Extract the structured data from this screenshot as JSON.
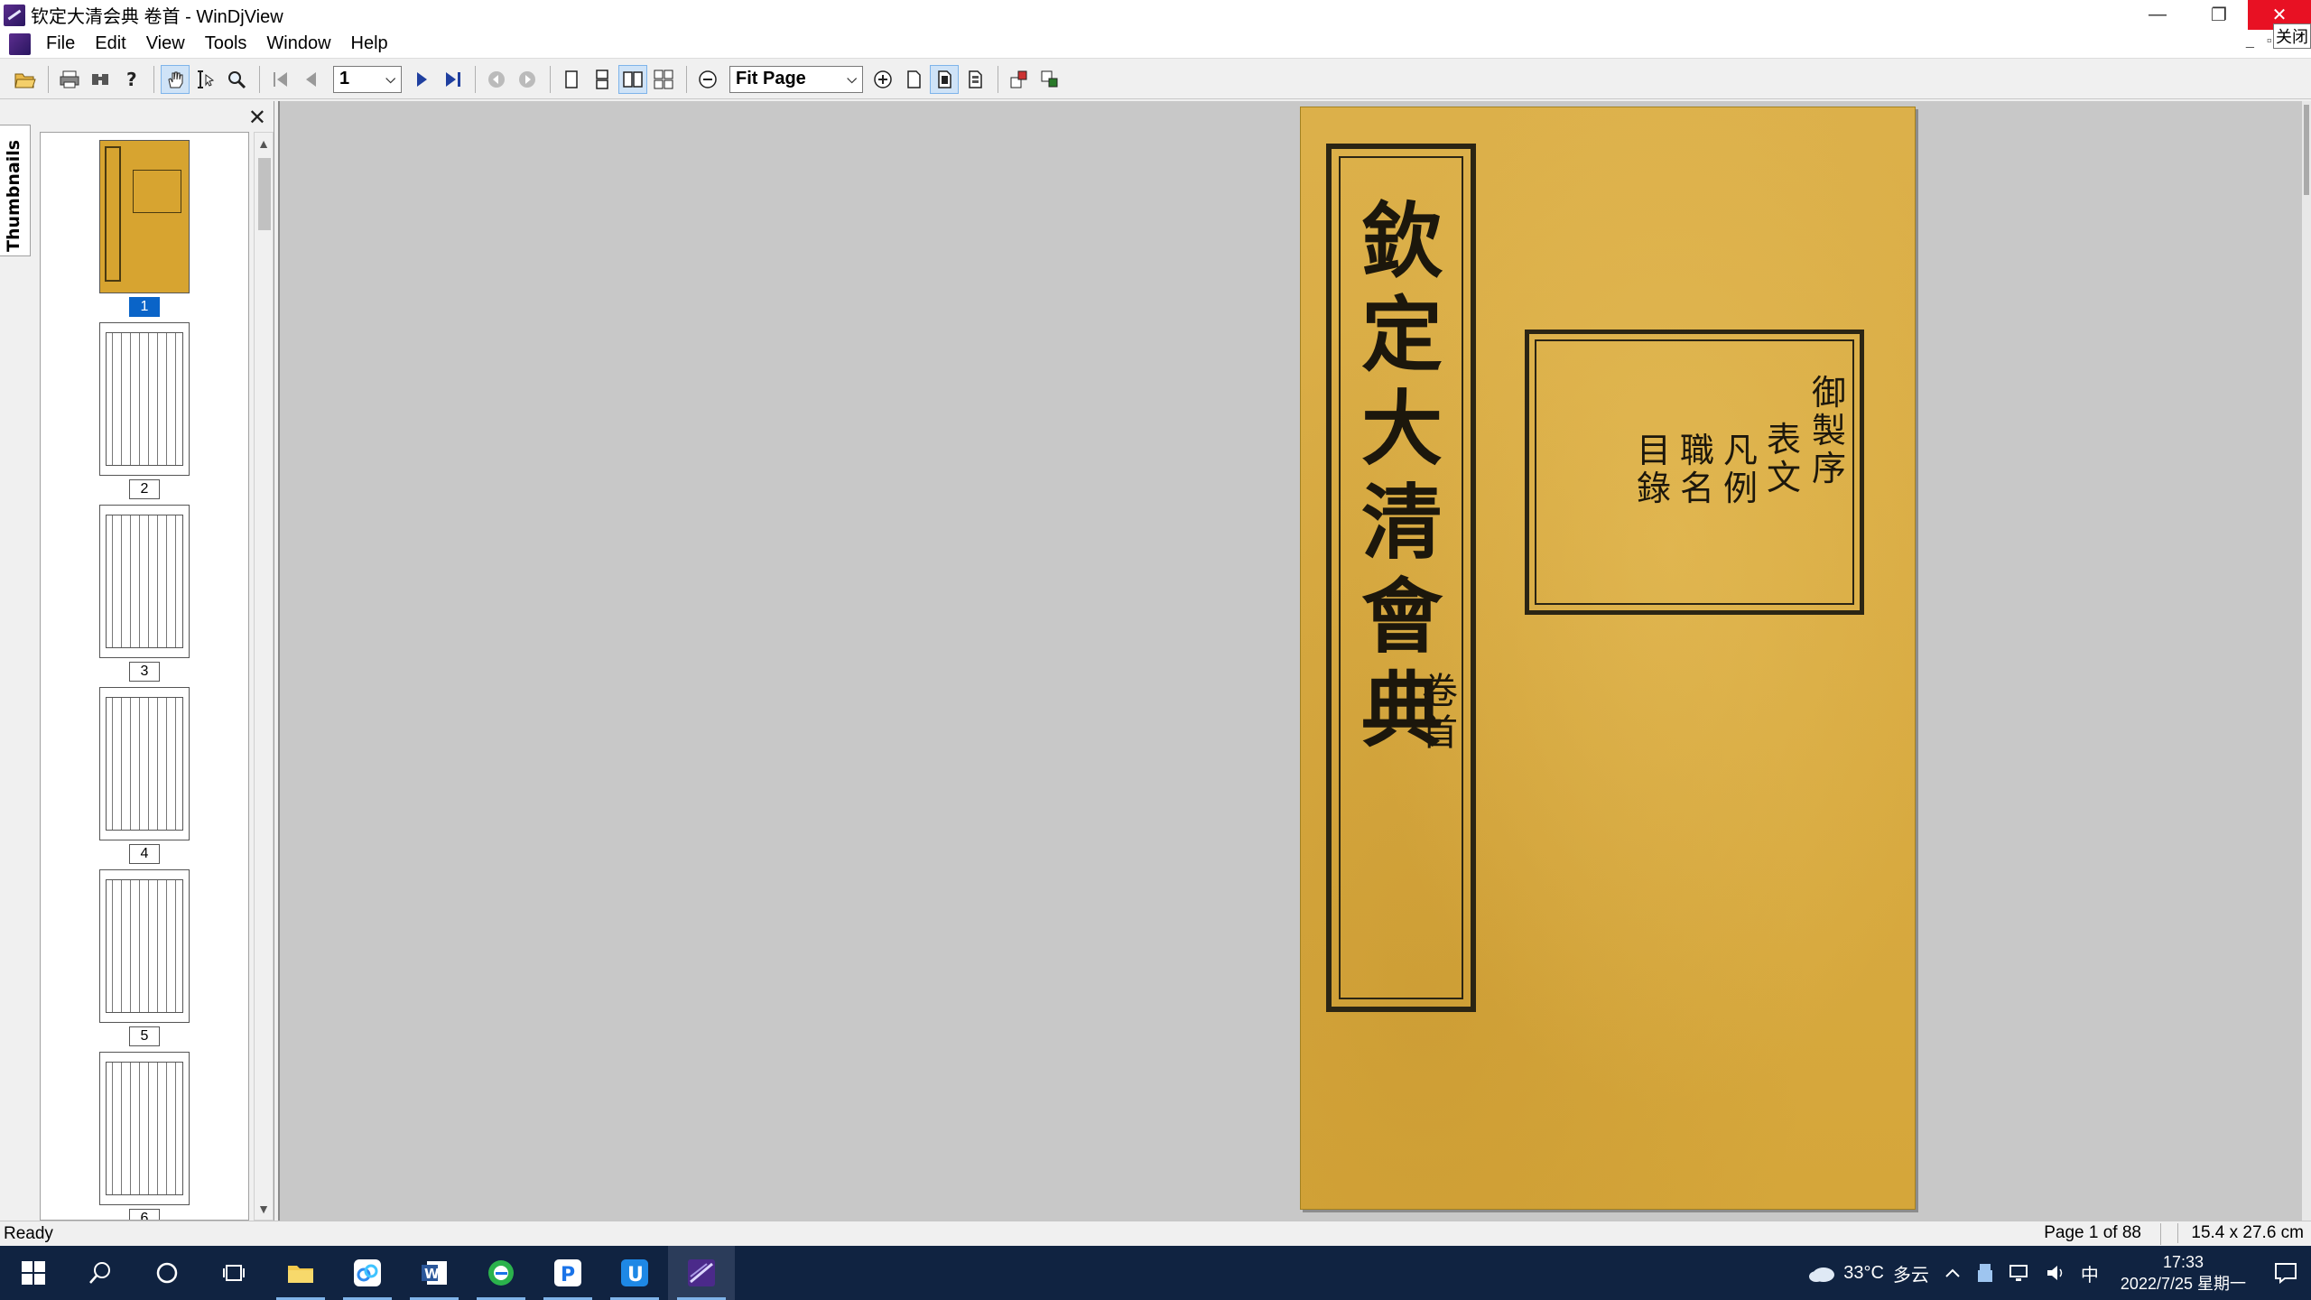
{
  "window": {
    "title": "钦定大清会典 卷首 - WinDjView",
    "close_tooltip": "关闭",
    "minimize_glyph": "—",
    "maximize_glyph": "❐",
    "close_glyph": "✕"
  },
  "menu": {
    "items": [
      "File",
      "Edit",
      "View",
      "Tools",
      "Window",
      "Help"
    ]
  },
  "toolbar": {
    "page_value": "1",
    "zoom_value": "Fit Page",
    "buttons": [
      "open-icon",
      "print-icon",
      "find-icon",
      "help-icon",
      "hand-tool-icon",
      "select-tool-icon",
      "zoom-tool-icon",
      "first-page-icon",
      "prev-page-icon",
      "next-page-icon",
      "last-page-icon",
      "back-icon",
      "forward-icon",
      "single-page-icon",
      "continuous-icon",
      "facing-icon",
      "facing-continuous-icon",
      "zoom-out-icon",
      "zoom-in-icon",
      "layout-1-icon",
      "layout-2-icon",
      "layout-3-icon",
      "rotate-left-icon",
      "rotate-right-icon"
    ]
  },
  "sidebar": {
    "tab_label": "Thumbnails",
    "thumbnails": [
      {
        "label": "1",
        "selected": true
      },
      {
        "label": "2",
        "selected": false
      },
      {
        "label": "3",
        "selected": false
      },
      {
        "label": "4",
        "selected": false
      },
      {
        "label": "5",
        "selected": false
      },
      {
        "label": "6",
        "selected": false
      }
    ]
  },
  "document": {
    "title_vertical": "欽定大清會典",
    "subtitle_vertical": "卷首",
    "contents_columns": [
      "御製序",
      "表文",
      "凡例",
      "職名",
      "目錄"
    ]
  },
  "status": {
    "left": "Ready",
    "page_info": "Page 1 of 88",
    "page_size": "15.4 x 27.6 cm"
  },
  "taskbar": {
    "weather_temp": "33°C",
    "weather_desc": "多云",
    "ime": "中",
    "time": "17:33",
    "date": "2022/7/25 星期一"
  }
}
